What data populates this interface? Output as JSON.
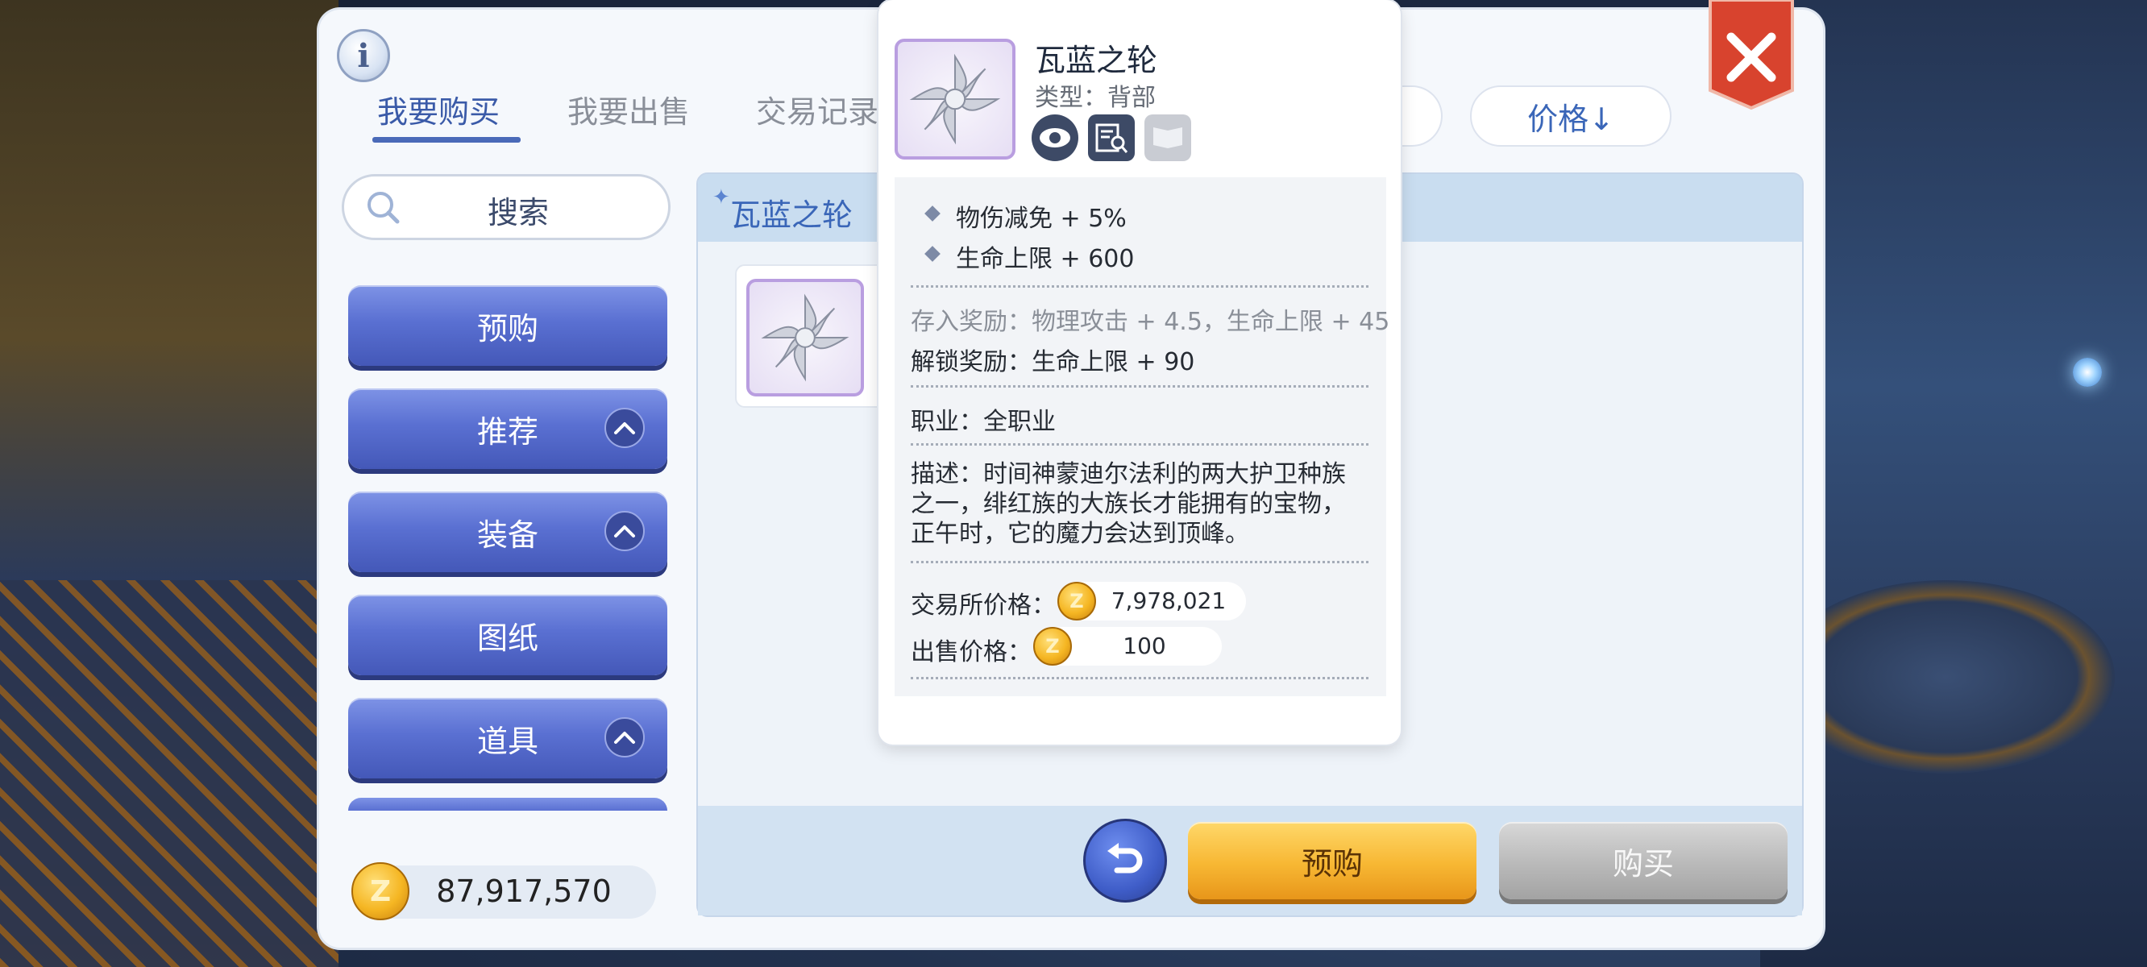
{
  "tabs": [
    {
      "label": "我要购买",
      "active": true
    },
    {
      "label": "我要出售",
      "active": false
    },
    {
      "label": "交易记录",
      "active": false
    }
  ],
  "sort": {
    "label": "价格↓"
  },
  "search": {
    "label": "搜索"
  },
  "sidebar": {
    "items": [
      {
        "label": "预购",
        "expandable": false
      },
      {
        "label": "推荐",
        "expandable": true
      },
      {
        "label": "装备",
        "expandable": true
      },
      {
        "label": "图纸",
        "expandable": false
      },
      {
        "label": "道具",
        "expandable": true
      }
    ]
  },
  "balance": {
    "value": "87,917,570",
    "coin_letter": "Z"
  },
  "list": {
    "header_title": "瓦蓝之轮"
  },
  "actions": {
    "preorder_label": "预购",
    "buy_label": "购买"
  },
  "tooltip": {
    "name": "瓦蓝之轮",
    "type_label": "类型：背部",
    "stats": [
      "物伤减免 + 5%",
      "生命上限 + 600"
    ],
    "deposit_reward": "存入奖励：物理攻击 + 4.5，生命上限 + 45",
    "unlock_reward": "解锁奖励：生命上限 + 90",
    "job": "职业：全职业",
    "description_lines": [
      "描述：时间神蒙迪尔法利的两大护卫种族",
      "之一，绯红族的大族长才能拥有的宝物，",
      "正午时，它的魔力会达到顶峰。"
    ],
    "exchange_price_label": "交易所价格：",
    "exchange_price": "7,978,021",
    "sell_price_label": "出售价格：",
    "sell_price": "100",
    "action_icons": [
      "eye-icon",
      "inspect-icon",
      "card-icon"
    ]
  },
  "colors": {
    "accent_blue": "#3a5aa8",
    "button_blue": "#5a70d2",
    "button_gold": "#f7b733",
    "button_grey": "#b9b9b9",
    "close_red": "#d8432e"
  }
}
